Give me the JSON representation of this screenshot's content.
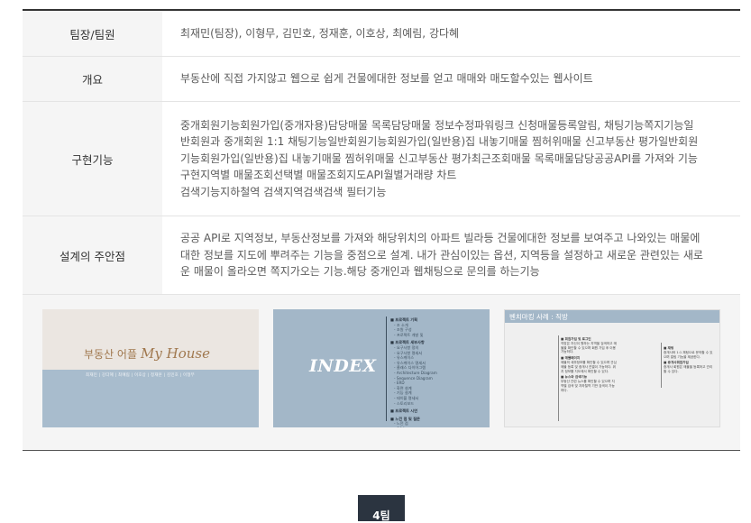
{
  "table": {
    "rows": [
      {
        "label": "팀장/팀원",
        "lines": [
          "최재민(팀장), 이형무, 김민호, 정재훈, 이호상, 최예림, 강다혜"
        ]
      },
      {
        "label": "개요",
        "lines": [
          "부동산에 직접 가지않고 웹으로 쉽게 건물에대한 정보를 얻고 매매와 매도할수있는 웹사이트"
        ]
      },
      {
        "label": "구현기능",
        "lines": [
          "중개회원기능회원가입(중개자용)담당매물 목록담당매물 정보수정파워링크 신청매물등록알림, 채팅기능쪽지기능일",
          "반회원과 중개회원 1:1 채팅기능일반회원기능회원가입(일반용)집 내놓기매물 찜허위매물 신고부동산 평가일반회원",
          "기능회원가입(일반용)집 내놓기매물 찜허위매물 신고부동산 평가최근조회매물 목록매물담당공공API를 가져와 기능",
          "구현지역별 매물조회선택별 매물조회지도API월별거래량 차트",
          "검색기능지하철역 검색지역검색검색 필터기능"
        ]
      },
      {
        "label": "설계의 주안점",
        "lines": [
          "공공 API로 지역정보, 부동산정보를 가져와 해당위치의 아파트 빌라등 건물에대한 정보를 보여주고 나와있는 매물에",
          "대한 정보를 지도에 뿌려주는 기능을 중점으로 설계. 내가 관심이있는 옵션, 지역등을 설정하고 새로운 관련있는 새로",
          "운 매물이 올라오면 쪽지가오는 기능.해당 중개인과 웹채팅으로 문의를 하는기능"
        ]
      }
    ]
  },
  "gallery": {
    "slide1": {
      "title_ko": "부동산 어플",
      "title_en": "My House",
      "names": "최재민 | 강다혜 | 최예림 | 이호상 | 정재훈 | 김민호 | 이형무"
    },
    "slide2": {
      "title": "INDEX",
      "toc": [
        {
          "h": "프로젝트 기획",
          "s": [
            "조 소개",
            "조원 구성",
            "프로젝트 개발 및"
          ]
        },
        {
          "h": "프로젝트 세부사항",
          "s": [
            "요구사항 정의",
            "요구사항 명세서",
            "유스케이스",
            "유스케이스 명세서",
            "클래스 다이어그램",
            "Architecture Diagram",
            "Sequence Diagram",
            "ERD",
            "화면 설계",
            "기능 설계",
            "테이블 명세서",
            "스토리보드"
          ]
        },
        {
          "h": "프로젝트 시연",
          "s": []
        },
        {
          "h": "느낀 점 및 질문",
          "s": [
            "느낀 점",
            "Q&A"
          ]
        }
      ]
    },
    "slide3": {
      "header": "벤치마킹 사례 : 직방",
      "colA": [
        {
          "b": "회원가입 및 로그인",
          "t": "직방은 자신이 원하는 지역을 검색하고 매물을 확인할 수 있으며 회원 가입 후 이용 가능하다."
        },
        {
          "b": "매물페이지",
          "t": "매물의 세부정보를 확인할 수 있으며 관심 매물 등록 및 중개사 연결이 가능하다. 위치 정보를 지도에서 확인할 수 있다."
        },
        {
          "b": "뉴스와 검색기능",
          "t": "부동산 관련 뉴스를 확인할 수 있으며 지역별 검색 및 지하철역 기반 검색이 가능하다."
        }
      ],
      "colB": [
        {
          "b": "채팅",
          "t": "중개사와 1:1 채팅으로 문의할 수 있으며 알림 기능을 제공한다."
        },
        {
          "b": "중개사회원가입",
          "t": "중개사 회원은 매물을 등록하고 관리할 수 있다."
        }
      ]
    }
  },
  "team_button": "4팀"
}
